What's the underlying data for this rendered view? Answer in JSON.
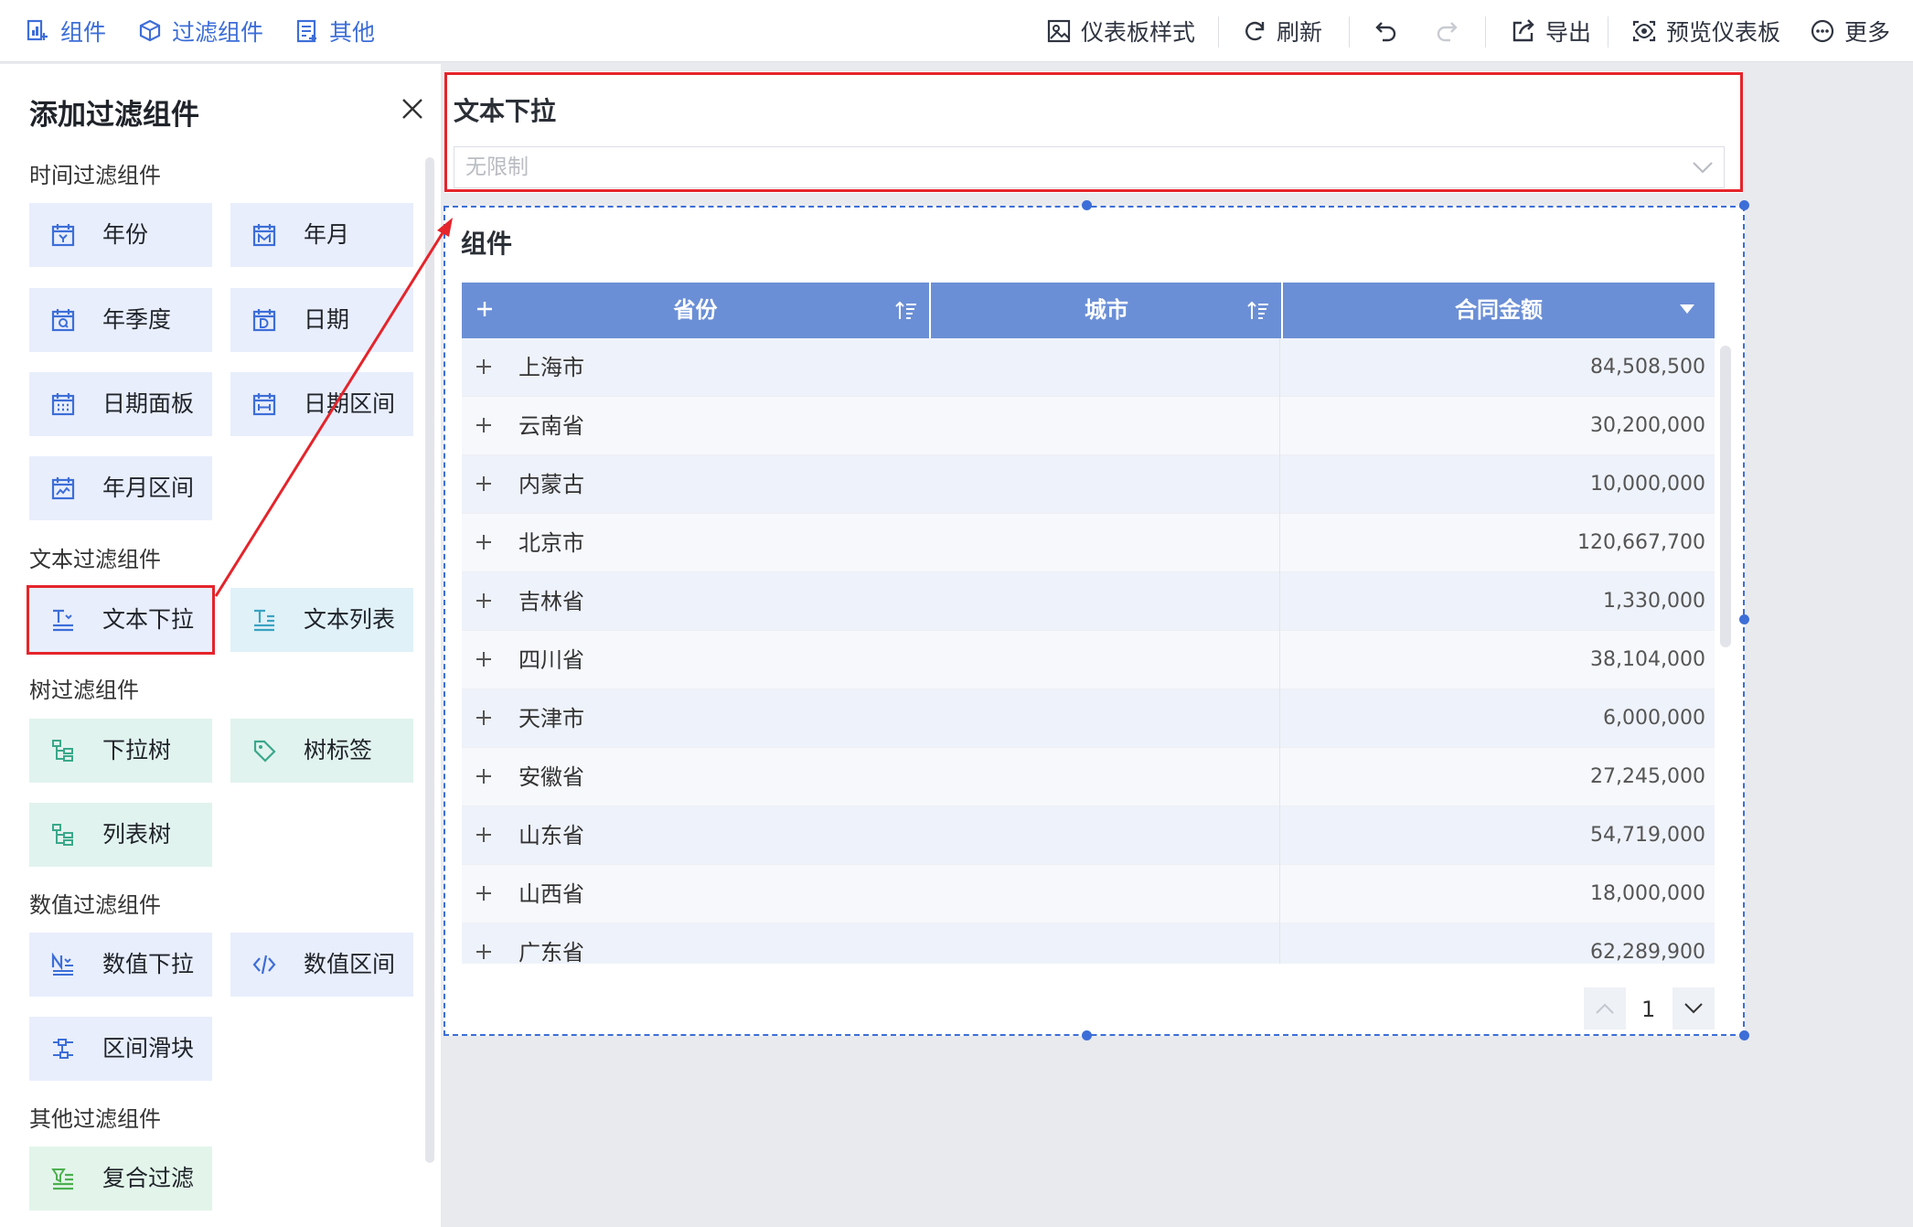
{
  "toolbar": {
    "left": [
      {
        "label": "组件",
        "icon": "component-icon"
      },
      {
        "label": "过滤组件",
        "icon": "filter-cube-icon"
      },
      {
        "label": "其他",
        "icon": "other-icon"
      }
    ],
    "right": {
      "style": "仪表板样式",
      "refresh": "刷新",
      "export": "导出",
      "preview": "预览仪表板",
      "more": "更多"
    }
  },
  "panel": {
    "title": "添加过滤组件",
    "sections": {
      "time": "时间过滤组件",
      "text": "文本过滤组件",
      "tree": "树过滤组件",
      "number": "数值过滤组件",
      "other": "其他过滤组件"
    },
    "items": {
      "year": "年份",
      "year_month": "年月",
      "year_quarter": "年季度",
      "date": "日期",
      "date_panel": "日期面板",
      "date_range": "日期区间",
      "year_month_range": "年月区间",
      "text_dropdown": "文本下拉",
      "text_list": "文本列表",
      "dropdown_tree": "下拉树",
      "tree_tag": "树标签",
      "list_tree": "列表树",
      "number_dropdown": "数值下拉",
      "number_range": "数值区间",
      "range_slider": "区间滑块",
      "composite_filter": "复合过滤"
    }
  },
  "filter_widget": {
    "title": "文本下拉",
    "placeholder": "无限制"
  },
  "table_widget": {
    "title": "组件",
    "columns": [
      "省份",
      "城市",
      "合同金额"
    ],
    "rows": [
      {
        "province": "上海市",
        "amount": "84,508,500"
      },
      {
        "province": "云南省",
        "amount": "30,200,000"
      },
      {
        "province": "内蒙古",
        "amount": "10,000,000"
      },
      {
        "province": "北京市",
        "amount": "120,667,700"
      },
      {
        "province": "吉林省",
        "amount": "1,330,000"
      },
      {
        "province": "四川省",
        "amount": "38,104,000"
      },
      {
        "province": "天津市",
        "amount": "6,000,000"
      },
      {
        "province": "安徽省",
        "amount": "27,245,000"
      },
      {
        "province": "山东省",
        "amount": "54,719,000"
      },
      {
        "province": "山西省",
        "amount": "18,000,000"
      },
      {
        "province": "广东省",
        "amount": "62,289,900"
      }
    ],
    "page": "1"
  },
  "colors": {
    "accent": "#3d6ed8",
    "header": "#6b8fd6",
    "highlight": "#e5242b",
    "tile_blue": "#e8eefc",
    "tile_green": "#e1f3ee"
  }
}
